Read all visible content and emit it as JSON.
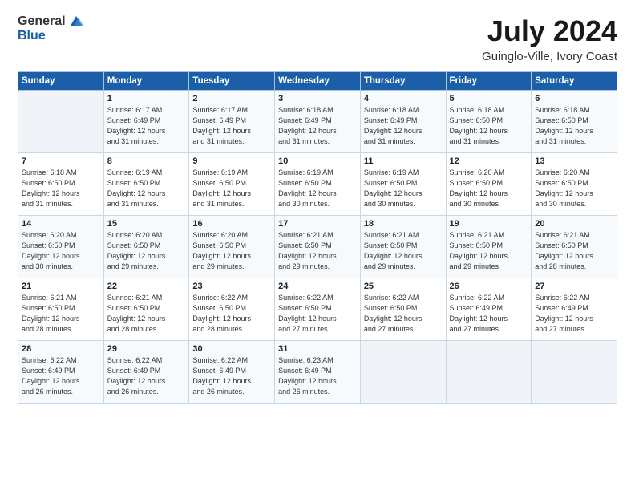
{
  "logo": {
    "text_general": "General",
    "text_blue": "Blue"
  },
  "title": "July 2024",
  "subtitle": "Guinglo-Ville, Ivory Coast",
  "header_days": [
    "Sunday",
    "Monday",
    "Tuesday",
    "Wednesday",
    "Thursday",
    "Friday",
    "Saturday"
  ],
  "weeks": [
    [
      {
        "day": "",
        "content": ""
      },
      {
        "day": "1",
        "content": "Sunrise: 6:17 AM\nSunset: 6:49 PM\nDaylight: 12 hours\nand 31 minutes."
      },
      {
        "day": "2",
        "content": "Sunrise: 6:17 AM\nSunset: 6:49 PM\nDaylight: 12 hours\nand 31 minutes."
      },
      {
        "day": "3",
        "content": "Sunrise: 6:18 AM\nSunset: 6:49 PM\nDaylight: 12 hours\nand 31 minutes."
      },
      {
        "day": "4",
        "content": "Sunrise: 6:18 AM\nSunset: 6:49 PM\nDaylight: 12 hours\nand 31 minutes."
      },
      {
        "day": "5",
        "content": "Sunrise: 6:18 AM\nSunset: 6:50 PM\nDaylight: 12 hours\nand 31 minutes."
      },
      {
        "day": "6",
        "content": "Sunrise: 6:18 AM\nSunset: 6:50 PM\nDaylight: 12 hours\nand 31 minutes."
      }
    ],
    [
      {
        "day": "7",
        "content": ""
      },
      {
        "day": "8",
        "content": "Sunrise: 6:19 AM\nSunset: 6:50 PM\nDaylight: 12 hours\nand 31 minutes."
      },
      {
        "day": "9",
        "content": "Sunrise: 6:19 AM\nSunset: 6:50 PM\nDaylight: 12 hours\nand 31 minutes."
      },
      {
        "day": "10",
        "content": "Sunrise: 6:19 AM\nSunset: 6:50 PM\nDaylight: 12 hours\nand 30 minutes."
      },
      {
        "day": "11",
        "content": "Sunrise: 6:19 AM\nSunset: 6:50 PM\nDaylight: 12 hours\nand 30 minutes."
      },
      {
        "day": "12",
        "content": "Sunrise: 6:20 AM\nSunset: 6:50 PM\nDaylight: 12 hours\nand 30 minutes."
      },
      {
        "day": "13",
        "content": "Sunrise: 6:20 AM\nSunset: 6:50 PM\nDaylight: 12 hours\nand 30 minutes."
      }
    ],
    [
      {
        "day": "14",
        "content": ""
      },
      {
        "day": "15",
        "content": "Sunrise: 6:20 AM\nSunset: 6:50 PM\nDaylight: 12 hours\nand 29 minutes."
      },
      {
        "day": "16",
        "content": "Sunrise: 6:20 AM\nSunset: 6:50 PM\nDaylight: 12 hours\nand 29 minutes."
      },
      {
        "day": "17",
        "content": "Sunrise: 6:21 AM\nSunset: 6:50 PM\nDaylight: 12 hours\nand 29 minutes."
      },
      {
        "day": "18",
        "content": "Sunrise: 6:21 AM\nSunset: 6:50 PM\nDaylight: 12 hours\nand 29 minutes."
      },
      {
        "day": "19",
        "content": "Sunrise: 6:21 AM\nSunset: 6:50 PM\nDaylight: 12 hours\nand 29 minutes."
      },
      {
        "day": "20",
        "content": "Sunrise: 6:21 AM\nSunset: 6:50 PM\nDaylight: 12 hours\nand 28 minutes."
      }
    ],
    [
      {
        "day": "21",
        "content": ""
      },
      {
        "day": "22",
        "content": "Sunrise: 6:21 AM\nSunset: 6:50 PM\nDaylight: 12 hours\nand 28 minutes."
      },
      {
        "day": "23",
        "content": "Sunrise: 6:22 AM\nSunset: 6:50 PM\nDaylight: 12 hours\nand 28 minutes."
      },
      {
        "day": "24",
        "content": "Sunrise: 6:22 AM\nSunset: 6:50 PM\nDaylight: 12 hours\nand 27 minutes."
      },
      {
        "day": "25",
        "content": "Sunrise: 6:22 AM\nSunset: 6:50 PM\nDaylight: 12 hours\nand 27 minutes."
      },
      {
        "day": "26",
        "content": "Sunrise: 6:22 AM\nSunset: 6:49 PM\nDaylight: 12 hours\nand 27 minutes."
      },
      {
        "day": "27",
        "content": "Sunrise: 6:22 AM\nSunset: 6:49 PM\nDaylight: 12 hours\nand 27 minutes."
      }
    ],
    [
      {
        "day": "28",
        "content": "Sunrise: 6:22 AM\nSunset: 6:49 PM\nDaylight: 12 hours\nand 26 minutes."
      },
      {
        "day": "29",
        "content": "Sunrise: 6:22 AM\nSunset: 6:49 PM\nDaylight: 12 hours\nand 26 minutes."
      },
      {
        "day": "30",
        "content": "Sunrise: 6:22 AM\nSunset: 6:49 PM\nDaylight: 12 hours\nand 26 minutes."
      },
      {
        "day": "31",
        "content": "Sunrise: 6:23 AM\nSunset: 6:49 PM\nDaylight: 12 hours\nand 26 minutes."
      },
      {
        "day": "",
        "content": ""
      },
      {
        "day": "",
        "content": ""
      },
      {
        "day": "",
        "content": ""
      }
    ]
  ],
  "week1_day7_content": "Sunrise: 6:18 AM\nSunset: 6:50 PM\nDaylight: 12 hours\nand 31 minutes.",
  "week2_day7_content": "Sunrise: 6:20 AM\nSunset: 6:50 PM\nDaylight: 12 hours\nand 30 minutes.",
  "week3_day14_content": "Sunrise: 6:20 AM\nSunset: 6:50 PM\nDaylight: 12 hours\nand 30 minutes.",
  "week4_day21_content": "Sunrise: 6:21 AM\nSunset: 6:50 PM\nDaylight: 12 hours\nand 28 minutes."
}
